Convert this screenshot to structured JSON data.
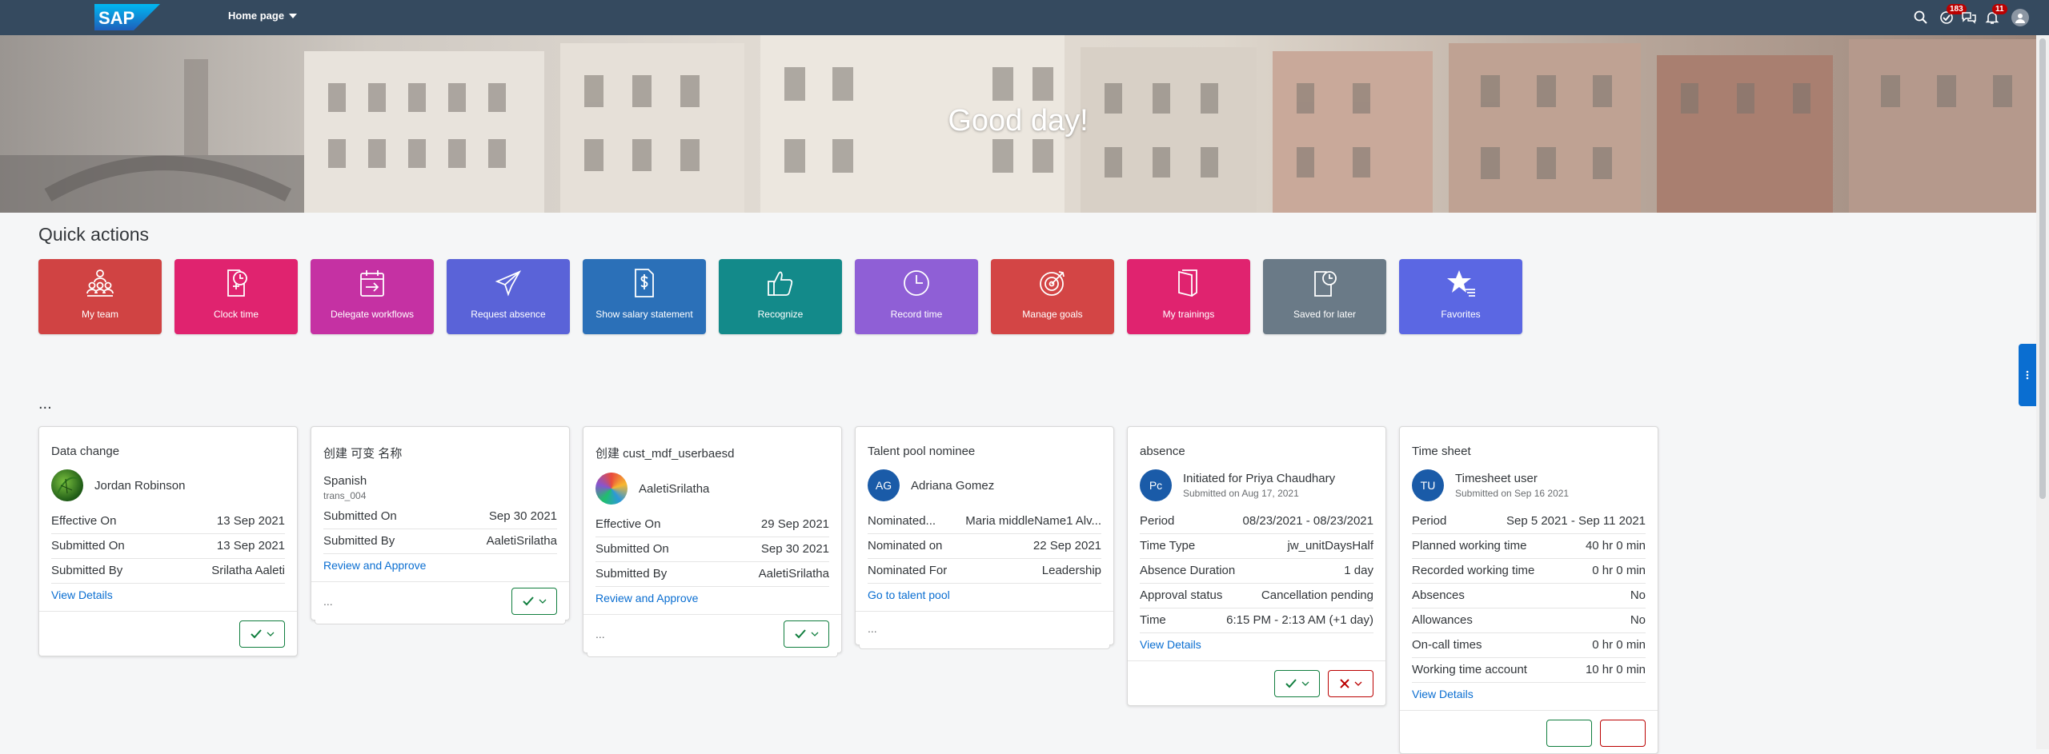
{
  "shell": {
    "logo_text": "SAP",
    "home_label": "Home page",
    "todo_badge": "183",
    "notif_badge": "11"
  },
  "hero": {
    "greeting": "Good day!"
  },
  "quick_actions": {
    "title": "Quick actions",
    "items": [
      {
        "label": "My team",
        "color": "#d04343",
        "icon": "team-icon"
      },
      {
        "label": "Clock time",
        "color": "#e0236f",
        "icon": "clock-time-icon"
      },
      {
        "label": "Delegate workflows",
        "color": "#c531a3",
        "icon": "delegate-icon"
      },
      {
        "label": "Request absence",
        "color": "#5a63d8",
        "icon": "airplane-icon"
      },
      {
        "label": "Show salary statement",
        "color": "#2b70b8",
        "icon": "salary-icon"
      },
      {
        "label": "Recognize",
        "color": "#138a8a",
        "icon": "thumbs-up-icon"
      },
      {
        "label": "Record time",
        "color": "#8f5fd6",
        "icon": "clock-icon"
      },
      {
        "label": "Manage goals",
        "color": "#d34545",
        "icon": "target-icon"
      },
      {
        "label": "My trainings",
        "color": "#e0236f",
        "icon": "book-icon"
      },
      {
        "label": "Saved for later",
        "color": "#6a7a87",
        "icon": "saved-icon"
      },
      {
        "label": "Favorites",
        "color": "#5b67e3",
        "icon": "star-icon"
      }
    ]
  },
  "section_dots": "...",
  "cards": {
    "c1": {
      "title": "Data change",
      "name": "Jordan Robinson",
      "rows": [
        [
          "Effective On",
          "13 Sep 2021"
        ],
        [
          "Submitted On",
          "13 Sep 2021"
        ],
        [
          "Submitted By",
          "Srilatha Aaleti"
        ]
      ],
      "link": "View Details"
    },
    "c2": {
      "title": "创建 可变 名称",
      "name": "Spanish",
      "sub": "trans_004",
      "rows": [
        [
          "Submitted On",
          "Sep 30 2021"
        ],
        [
          "Submitted By",
          "AaletiSrilatha"
        ]
      ],
      "link": "Review and Approve",
      "foot_dots": "..."
    },
    "c3": {
      "title": "创建 cust_mdf_userbaesd",
      "name": "AaletiSrilatha",
      "rows": [
        [
          "Effective On",
          "29 Sep 2021"
        ],
        [
          "Submitted On",
          "Sep 30 2021"
        ],
        [
          "Submitted By",
          "AaletiSrilatha"
        ]
      ],
      "link": "Review and Approve",
      "foot_dots": "..."
    },
    "c4": {
      "title": "Talent pool nominee",
      "initials": "AG",
      "name": "Adriana Gomez",
      "rows": [
        [
          "Nominated...",
          "Maria middleName1 Alv..."
        ],
        [
          "Nominated on",
          "22 Sep 2021"
        ],
        [
          "Nominated For",
          "Leadership"
        ]
      ],
      "link": "Go to talent pool",
      "foot_dots": "..."
    },
    "c5": {
      "title": "absence",
      "initials": "Pc",
      "name": "Initiated for Priya Chaudhary",
      "sub": "Submitted on Aug 17, 2021",
      "rows": [
        [
          "Period",
          "08/23/2021 - 08/23/2021"
        ],
        [
          "Time Type",
          "jw_unitDaysHalf"
        ],
        [
          "Absence Duration",
          "1 day"
        ],
        [
          "Approval status",
          "Cancellation pending"
        ],
        [
          "Time",
          "6:15 PM - 2:13 AM (+1 day)"
        ]
      ],
      "link": "View Details"
    },
    "c6": {
      "title": "Time sheet",
      "initials": "TU",
      "name": "Timesheet user",
      "sub": "Submitted on Sep 16 2021",
      "rows": [
        [
          "Period",
          "Sep 5 2021 - Sep 11 2021"
        ],
        [
          "Planned working time",
          "40 hr 0 min"
        ],
        [
          "Recorded working time",
          "0 hr 0 min"
        ],
        [
          "Absences",
          "No"
        ],
        [
          "Allowances",
          "No"
        ],
        [
          "On-call times",
          "0 hr 0 min"
        ],
        [
          "Working time account",
          "10 hr 0 min"
        ]
      ],
      "link": "View Details"
    }
  }
}
